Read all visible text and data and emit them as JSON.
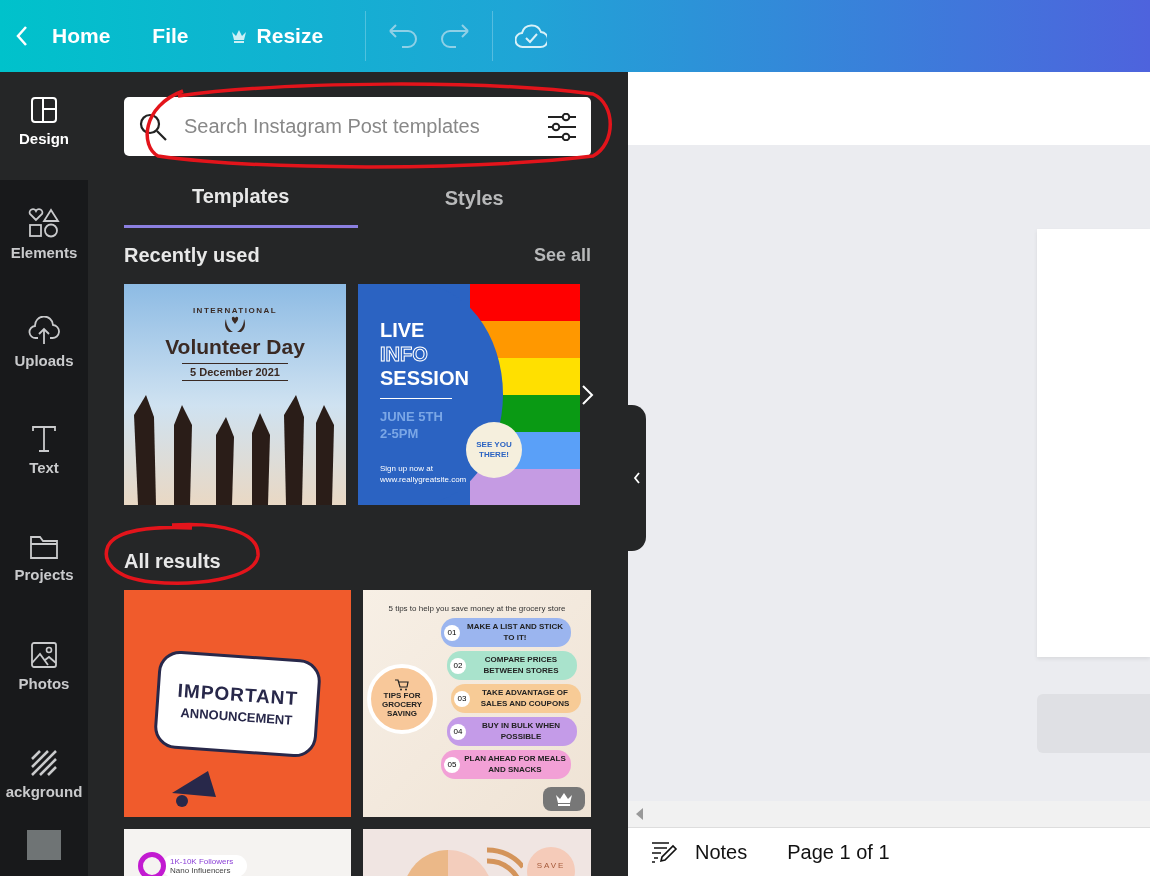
{
  "topbar": {
    "menu": [
      {
        "label": "Home",
        "kind": "back"
      },
      {
        "label": "File",
        "kind": "plain"
      },
      {
        "label": "Resize",
        "kind": "premium"
      }
    ]
  },
  "sidebar": {
    "items": [
      {
        "label": "Design",
        "selected": true
      },
      {
        "label": "Elements",
        "selected": false
      },
      {
        "label": "Uploads",
        "selected": false
      },
      {
        "label": "Text",
        "selected": false
      },
      {
        "label": "Projects",
        "selected": false
      },
      {
        "label": "Photos",
        "selected": false
      },
      {
        "label": "ackground",
        "selected": false
      }
    ]
  },
  "search": {
    "placeholder": "Search Instagram Post templates"
  },
  "tabs": [
    {
      "label": "Templates",
      "selected": true
    },
    {
      "label": "Styles",
      "selected": false
    }
  ],
  "recent": {
    "heading": "Recently used",
    "link": "See all",
    "templates": [
      {
        "kind": "volunteer",
        "arc": "INTERNATIONAL",
        "title": "Volunteer Day",
        "date": "5 December 2021"
      },
      {
        "kind": "info",
        "lines": [
          "LIVE",
          "INFO",
          "SESSION"
        ],
        "when": [
          "JUNE 5TH",
          "2-5PM"
        ],
        "footer": [
          "Sign up now at",
          "www.reallygreatsite.com"
        ],
        "badge": "SEE YOU THERE!"
      }
    ]
  },
  "results": {
    "heading": "All results",
    "templates": [
      {
        "kind": "announcement",
        "lines": [
          "IMPORTANT",
          "ANNOUNCEMENT"
        ]
      },
      {
        "kind": "grocery",
        "title": "5 tips to help you save money at the grocery store",
        "center": "TIPS FOR GROCERY SAVING",
        "premium": true,
        "tips": [
          {
            "num": "01",
            "text": "MAKE A LIST AND STICK TO IT!",
            "color": "#9bb5ef"
          },
          {
            "num": "02",
            "text": "COMPARE PRICES BETWEEN STORES",
            "color": "#a9e3cc"
          },
          {
            "num": "03",
            "text": "TAKE ADVANTAGE OF SALES AND COUPONS",
            "color": "#f7cb96"
          },
          {
            "num": "04",
            "text": "BUY IN BULK WHEN POSSIBLE",
            "color": "#c49be8"
          },
          {
            "num": "05",
            "text": "PLAN AHEAD FOR MEALS AND SNACKS",
            "color": "#f2a0d6"
          }
        ]
      },
      {
        "kind": "influencer",
        "lines": [
          "1K-10K Followers",
          "Nano Influencers"
        ]
      },
      {
        "kind": "abstract",
        "word": "SAVE"
      }
    ]
  },
  "notes": {
    "label": "Notes"
  },
  "page_indicator": "Page 1 of 1"
}
